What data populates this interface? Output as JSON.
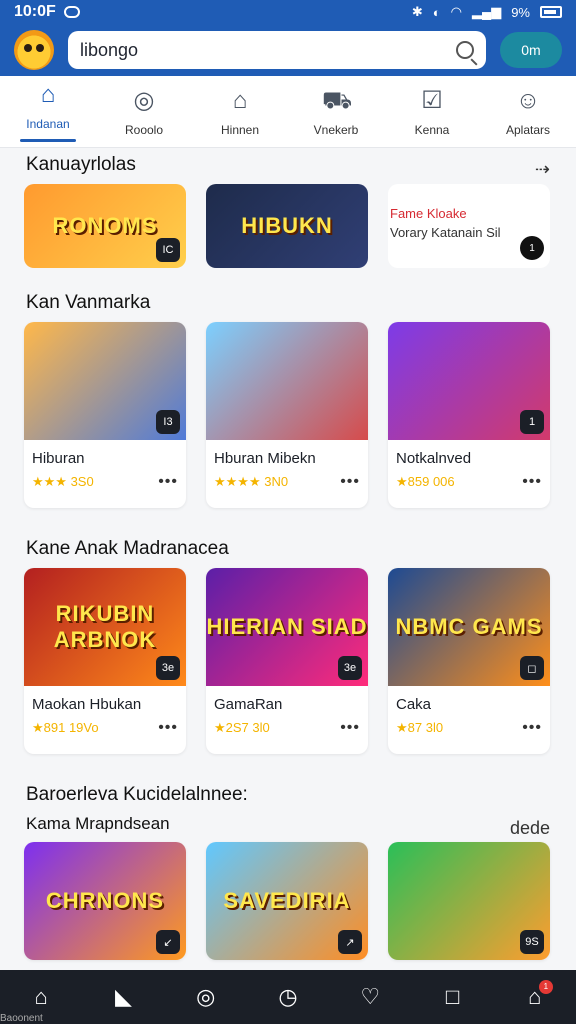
{
  "status": {
    "time": "10:0F",
    "battery": "9%"
  },
  "header": {
    "search_value": "libongo",
    "button_label": "0m"
  },
  "top_nav": [
    {
      "label": "Indanan",
      "icon": "home-icon"
    },
    {
      "label": "Rooolo",
      "icon": "camera-icon"
    },
    {
      "label": "Hinnen",
      "icon": "house-plus-icon"
    },
    {
      "label": "Vnekerb",
      "icon": "car-icon"
    },
    {
      "label": "Kenna",
      "icon": "checkbox-icon"
    },
    {
      "label": "Aplatars",
      "icon": "user-group-icon"
    }
  ],
  "section_1": {
    "title": "Kanuayrlolas",
    "cards": [
      {
        "text": "RONOMS",
        "badge": "IC"
      },
      {
        "text": "HIBUKN",
        "badge": ""
      }
    ],
    "text_card": {
      "name": "Fame Kloake",
      "subtitle": "Vorary Katanain Sil",
      "badge": "1"
    }
  },
  "section_2": {
    "title": "Kan Vanmarka",
    "cards": [
      {
        "title": "Hiburan",
        "rating": "★★★ 3S0",
        "badge": "I3"
      },
      {
        "title": "Hburan Mibekn",
        "rating": "★★★★ 3N0",
        "badge": ""
      },
      {
        "title": "Notkalnved",
        "rating": "★859 006",
        "badge": "1"
      }
    ]
  },
  "section_3": {
    "title": "Kane Anak Madranacea",
    "cards": [
      {
        "title": "Maokan Hbukan",
        "rating": "★891 19Vo",
        "thumb": "RIKUBIN\nARBNOK",
        "badge": "3e"
      },
      {
        "title": "GamaRan",
        "rating": "★2S7 3l0",
        "thumb": "HIERIAN\nSIAD",
        "badge": "3e"
      },
      {
        "title": "Caka",
        "rating": "★87 3l0",
        "thumb": "NBMC\nGAMS",
        "badge": "◻"
      }
    ]
  },
  "section_4": {
    "title": "Baroerleva Kucidelalnnee:",
    "subtitle": "Kama Mrapndsean",
    "link": "dede",
    "cards": [
      {
        "thumb": "CHRNONS",
        "badge": "↙"
      },
      {
        "thumb": "SAVEDIRIA",
        "badge": "↗"
      },
      {
        "thumb": "",
        "badge": "9S"
      }
    ]
  },
  "bottom_nav": [
    {
      "icon": "home-icon",
      "label": "Baoonent"
    },
    {
      "icon": "play-icon",
      "label": ""
    },
    {
      "icon": "gamepad-icon",
      "label": ""
    },
    {
      "icon": "clock-icon",
      "label": ""
    },
    {
      "icon": "heart-icon",
      "label": ""
    },
    {
      "icon": "square-icon",
      "label": ""
    },
    {
      "icon": "cart-icon",
      "label": "",
      "badge": "1"
    }
  ]
}
